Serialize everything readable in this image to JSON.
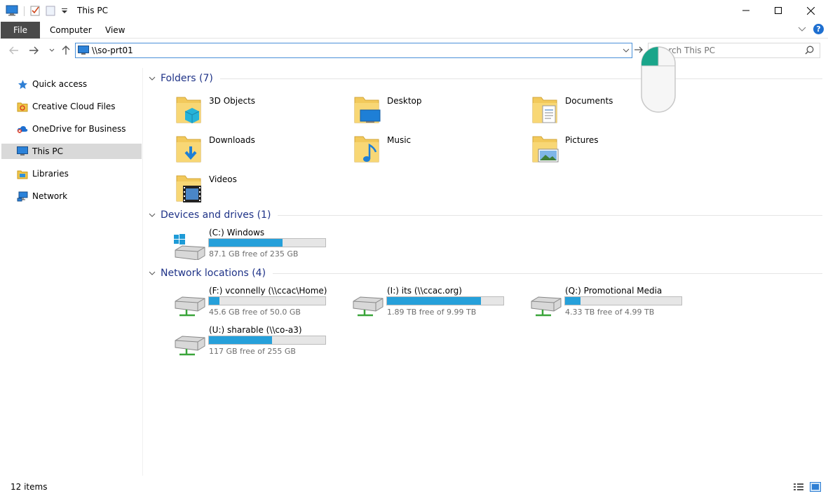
{
  "window": {
    "title": "This PC"
  },
  "ribbon": {
    "tabs": [
      "File",
      "Computer",
      "View"
    ]
  },
  "address": {
    "value": "\\\\so-prt01"
  },
  "search": {
    "placeholder": "Search This PC"
  },
  "sidebar": {
    "items": [
      {
        "label": "Quick access",
        "icon": "star-icon"
      },
      {
        "label": "Creative Cloud Files",
        "icon": "creative-cloud-folder-icon"
      },
      {
        "label": "OneDrive for Business",
        "icon": "onedrive-icon"
      },
      {
        "label": "This PC",
        "icon": "computer-icon",
        "selected": true
      },
      {
        "label": "Libraries",
        "icon": "libraries-icon"
      },
      {
        "label": "Network",
        "icon": "network-icon"
      }
    ]
  },
  "groups": {
    "folders": {
      "title": "Folders (7)"
    },
    "devices": {
      "title": "Devices and drives (1)"
    },
    "network": {
      "title": "Network locations (4)"
    }
  },
  "folders": [
    {
      "label": "3D Objects",
      "icon": "3d-objects-folder-icon"
    },
    {
      "label": "Desktop",
      "icon": "desktop-folder-icon"
    },
    {
      "label": "Documents",
      "icon": "documents-folder-icon"
    },
    {
      "label": "Downloads",
      "icon": "downloads-folder-icon"
    },
    {
      "label": "Music",
      "icon": "music-folder-icon"
    },
    {
      "label": "Pictures",
      "icon": "pictures-folder-icon"
    },
    {
      "label": "Videos",
      "icon": "videos-folder-icon"
    }
  ],
  "drives": [
    {
      "label": "(C:) Windows",
      "free": "87.1 GB free of 235 GB",
      "used_fraction": 0.63
    }
  ],
  "network_locations": [
    {
      "label": "(F:) vconnelly (\\\\ccac\\Home)",
      "free": "45.6 GB free of 50.0 GB",
      "used_fraction": 0.09
    },
    {
      "label": "(I:) its (\\\\ccac.org)",
      "free": "1.89 TB free of 9.99 TB",
      "used_fraction": 0.81
    },
    {
      "label": "(Q:) Promotional Media",
      "free": "4.33 TB free of 4.99 TB",
      "used_fraction": 0.13
    },
    {
      "label": "(U:) sharable (\\\\co-a3)",
      "free": "117 GB free of 255 GB",
      "used_fraction": 0.54
    }
  ],
  "status": {
    "item_count": "12 items"
  },
  "colors": {
    "accent": "#26a0da",
    "group_title": "#1e3287",
    "file_tab": "#4a4a4a"
  }
}
